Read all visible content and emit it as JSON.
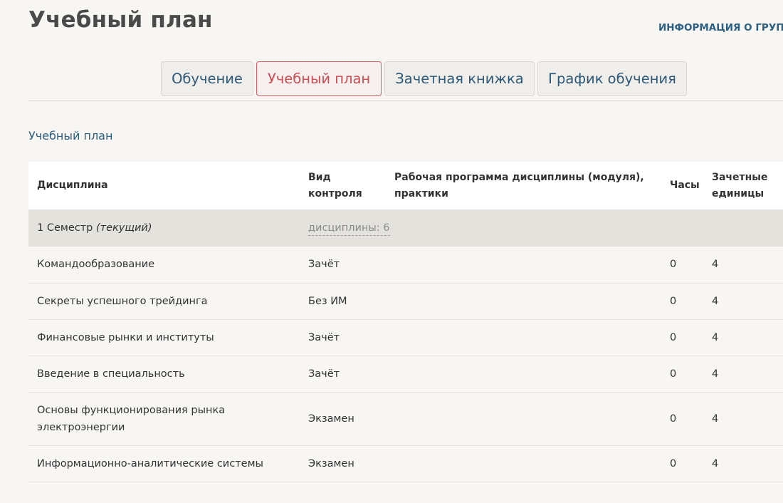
{
  "header": {
    "title": "Учебный план",
    "group_info_link": "ИНФОРМАЦИЯ О ГРУПП"
  },
  "tabs": [
    {
      "label": "Обучение",
      "active": false
    },
    {
      "label": "Учебный план",
      "active": true
    },
    {
      "label": "Зачетная книжка",
      "active": false
    },
    {
      "label": "График обучения",
      "active": false
    }
  ],
  "section": {
    "title": "Учебный план"
  },
  "table": {
    "columns": {
      "discipline": "Дисциплина",
      "control_type": "Вид контроля",
      "work_program": "Рабочая программа дисциплины (модуля), практики",
      "hours": "Часы",
      "credits": "Зачетные единицы"
    },
    "semester": {
      "label": "1 Семестр",
      "note": "(текущий)",
      "disciplines_count": "дисциплины: 6"
    },
    "rows": [
      {
        "discipline": "Командообразование",
        "control": "Зачёт",
        "program": "",
        "hours": "0",
        "credits": "4"
      },
      {
        "discipline": "Секреты успешного трейдинга",
        "control": "Без ИМ",
        "program": "",
        "hours": "0",
        "credits": "4"
      },
      {
        "discipline": "Финансовые рынки и институты",
        "control": "Зачёт",
        "program": "",
        "hours": "0",
        "credits": "4"
      },
      {
        "discipline": "Введение в специальность",
        "control": "Зачёт",
        "program": "",
        "hours": "0",
        "credits": "4"
      },
      {
        "discipline": "Основы функционирования рынка электроэнергии",
        "control": "Экзамен",
        "program": "",
        "hours": "0",
        "credits": "4"
      },
      {
        "discipline": "Информационно-аналитические системы",
        "control": "Экзамен",
        "program": "",
        "hours": "0",
        "credits": "4"
      }
    ]
  },
  "colors": {
    "background": "#f7f6f3",
    "link": "#2c5f84",
    "active_tab": "#cc4b53",
    "semester_row": "#e3e2dd"
  }
}
